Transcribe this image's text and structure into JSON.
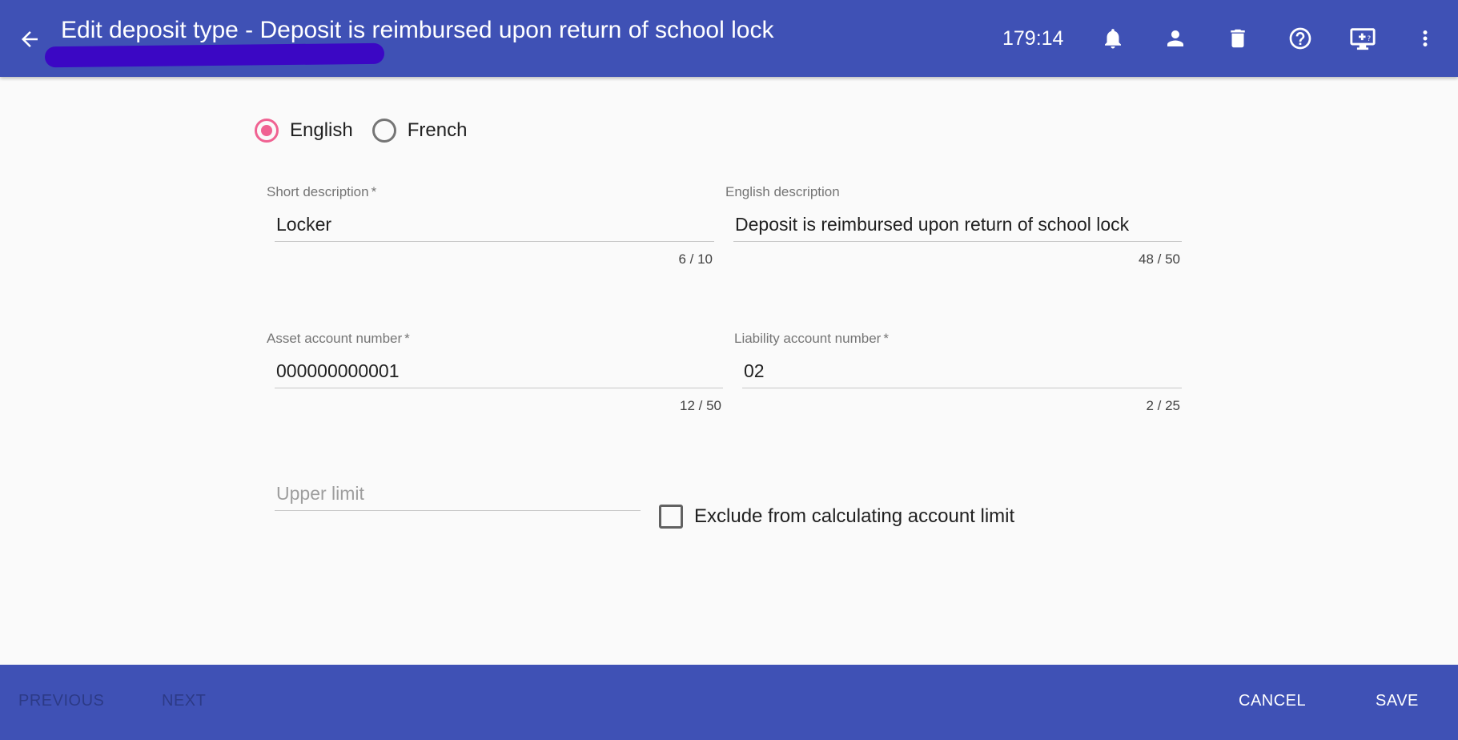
{
  "header": {
    "title": "Edit deposit type - Deposit is reimbursed upon return of school lock",
    "timer": "179:14",
    "icons": [
      "back-arrow-icon",
      "bell-icon",
      "person-icon",
      "trash-icon",
      "help-circle-icon",
      "desktop-help-icon",
      "more-vert-icon"
    ]
  },
  "language": {
    "options": [
      "English",
      "French"
    ],
    "selected": "English"
  },
  "form": {
    "short_description": {
      "label": "Short description",
      "required": "*",
      "value": "Locker",
      "counter": "6 / 10"
    },
    "english_description": {
      "label": "English description",
      "value": "Deposit is reimbursed upon return of school lock",
      "counter": "48 / 50"
    },
    "asset_account": {
      "label": "Asset account number",
      "required": "*",
      "value": "000000000001",
      "counter": "12 / 50"
    },
    "liability_account": {
      "label": "Liability account number",
      "required": "*",
      "value": "02",
      "counter": "2 / 25"
    },
    "upper_limit": {
      "placeholder": "Upper limit",
      "value": ""
    },
    "exclude_checkbox": {
      "label": "Exclude from calculating account limit",
      "checked": false
    }
  },
  "footer": {
    "previous": "PREVIOUS",
    "next": "NEXT",
    "cancel": "CANCEL",
    "save": "SAVE"
  },
  "colors": {
    "primary": "#3f51b5",
    "accent": "#f06292",
    "scribble": "#3b07c4"
  }
}
